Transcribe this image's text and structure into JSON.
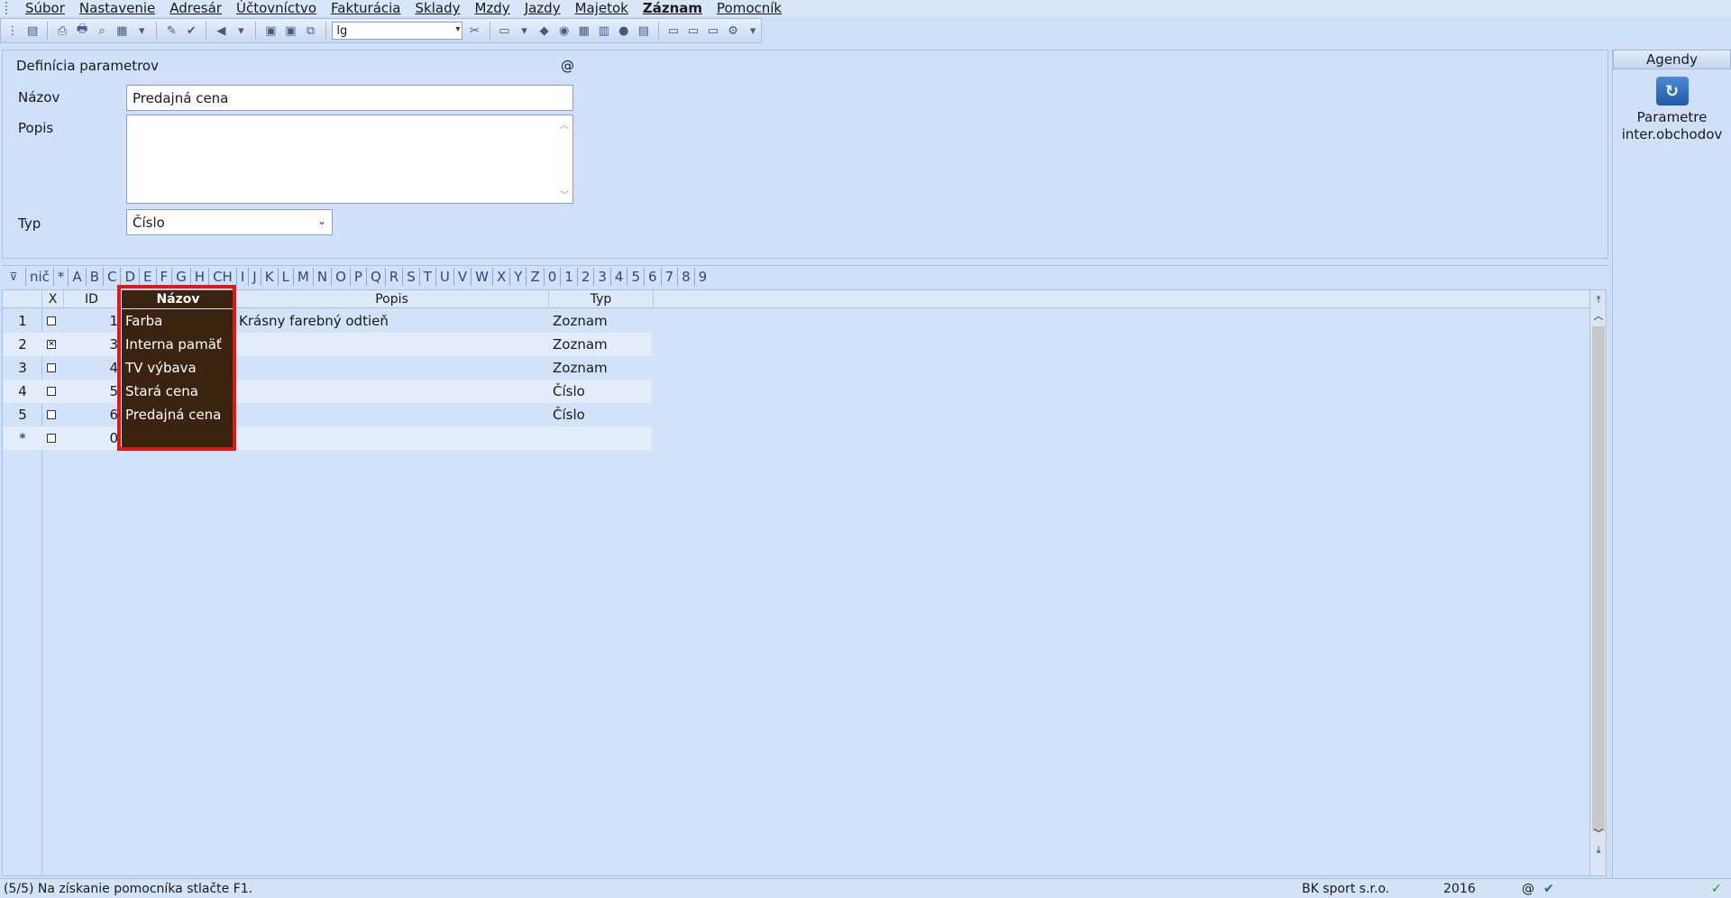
{
  "menu": [
    "Súbor",
    "Nastavenie",
    "Adresár",
    "Účtovníctvo",
    "Fakturácia",
    "Sklady",
    "Mzdy",
    "Jazdy",
    "Majetok",
    "Záznam",
    "Pomocník"
  ],
  "menu_bold_index": 9,
  "toolbar": {
    "combo_value": "lg"
  },
  "form": {
    "section_title": "Definícia parametrov",
    "at_symbol": "@",
    "nazov_label": "Názov",
    "nazov_value": "Predajná cena",
    "popis_label": "Popis",
    "popis_value": "",
    "typ_label": "Typ",
    "typ_value": "Číslo"
  },
  "agendy": {
    "title": "Agendy",
    "item_label_1": "Parametre",
    "item_label_2": "inter.obchodov"
  },
  "alphabet": [
    "nič",
    "*",
    "A",
    "B",
    "C",
    "D",
    "E",
    "F",
    "G",
    "H",
    "CH",
    "I",
    "J",
    "K",
    "L",
    "M",
    "N",
    "O",
    "P",
    "Q",
    "R",
    "S",
    "T",
    "U",
    "V",
    "W",
    "X",
    "Y",
    "Z",
    "0",
    "1",
    "2",
    "3",
    "4",
    "5",
    "6",
    "7",
    "8",
    "9"
  ],
  "grid": {
    "columns": {
      "x": "X",
      "id": "ID",
      "nazov": "Názov",
      "popis": "Popis",
      "typ": "Typ"
    },
    "rows": [
      {
        "num": "1",
        "checked": false,
        "id": "1",
        "nazov": "Farba",
        "popis": "Krásny farebný odtieň",
        "typ": "Zoznam"
      },
      {
        "num": "2",
        "checked": true,
        "id": "3",
        "nazov": "Interna pamäť",
        "popis": "",
        "typ": "Zoznam"
      },
      {
        "num": "3",
        "checked": false,
        "id": "4",
        "nazov": "TV výbava",
        "popis": "",
        "typ": "Zoznam"
      },
      {
        "num": "4",
        "checked": false,
        "id": "5",
        "nazov": "Stará cena",
        "popis": "",
        "typ": "Číslo"
      },
      {
        "num": "5",
        "checked": false,
        "id": "6",
        "nazov": "Predajná cena",
        "popis": "",
        "typ": "Číslo"
      },
      {
        "num": "*",
        "checked": false,
        "id": "0",
        "nazov": "",
        "popis": "",
        "typ": ""
      }
    ]
  },
  "status": {
    "message": "(5/5) Na získanie pomocníka stlačte F1.",
    "company": "BK sport  s.r.o.",
    "year": "2016",
    "at": "@"
  }
}
